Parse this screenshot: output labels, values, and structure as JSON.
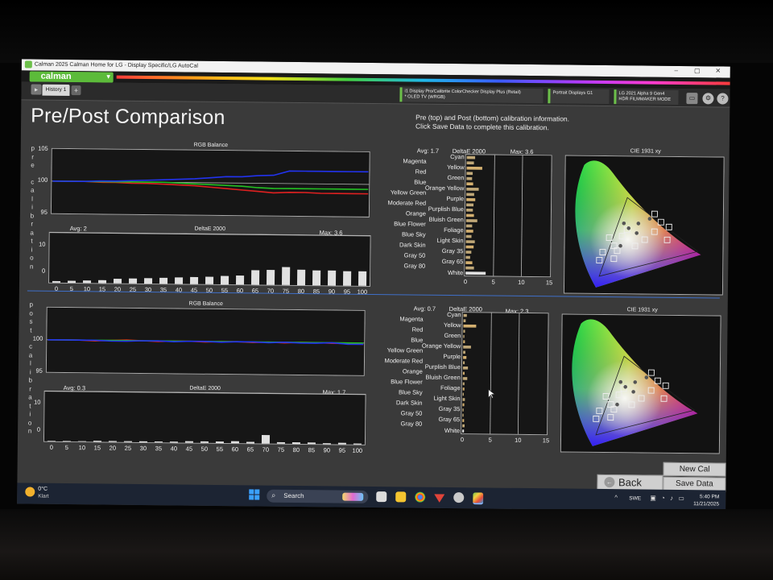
{
  "window": {
    "title": "Calman 2025 Calman Home for LG  - Display Specific/LG AutoCal",
    "min": "–",
    "max": "▢",
    "close": "✕"
  },
  "brand": {
    "name": "calman",
    "dropdown": "▾"
  },
  "tabs": {
    "history_label": "History 1",
    "add_label": "+",
    "devices": [
      {
        "line1": "i1 Display Pro/Calibrite ColorChecker Display Plus (Retail)",
        "line2": "* OLED TV (WRGB)"
      },
      {
        "line1": "Portrait Displays G1",
        "line2": ""
      },
      {
        "line1": "LG 2021 Alpha 9 Gen4",
        "line2": "HDR FILMMAKER MODE"
      }
    ]
  },
  "page": {
    "title": "Pre/Post Comparison",
    "info_line1": "Pre (top) and Post (bottom) calibration information.",
    "info_line2": "Click Save Data to complete this calibration."
  },
  "side_labels": {
    "pre": "pre calibration",
    "post": "post calibration"
  },
  "colors": {
    "accent": "#6cc04a",
    "red": "#e02020",
    "green": "#22c022",
    "blue": "#2233ee",
    "bar": "#d4b070",
    "bar_gray": "#e0e0e0"
  },
  "chart_data": [
    {
      "type": "line",
      "id": "pre-rgb-balance",
      "title": "RGB Balance",
      "x": [
        0,
        5,
        10,
        15,
        20,
        25,
        30,
        35,
        40,
        45,
        50,
        55,
        60,
        65,
        70,
        75,
        80,
        85,
        90,
        95,
        100
      ],
      "ylim": [
        95,
        105
      ],
      "yticks": [
        "105",
        "100",
        "95"
      ],
      "series": [
        {
          "color": "red",
          "values": [
            100,
            100,
            100,
            99.9,
            99.9,
            99.8,
            99.8,
            99.7,
            99.6,
            99.5,
            99.3,
            99.1,
            98.9,
            98.7,
            98.5,
            98.6,
            98.6,
            98.5,
            98.5,
            98.5,
            98.5
          ]
        },
        {
          "color": "green",
          "values": [
            100,
            100,
            100,
            100,
            100,
            100,
            100,
            100,
            99.9,
            99.8,
            99.7,
            99.6,
            99.5,
            99.3,
            99.2,
            99.2,
            99.2,
            99.2,
            99.2,
            99.2,
            99.2
          ]
        },
        {
          "color": "blue",
          "values": [
            100,
            100,
            100,
            100.1,
            100.1,
            100.2,
            100.3,
            100.4,
            100.5,
            100.6,
            100.8,
            101,
            101,
            101.2,
            101.3,
            102,
            102,
            102,
            102,
            102,
            102
          ]
        }
      ]
    },
    {
      "type": "bar",
      "id": "pre-deltae-grayscale",
      "title": "DeltaE 2000",
      "avg": "Avg: 2",
      "max": "Max: 3.6",
      "categories": [
        "0",
        "5",
        "10",
        "15",
        "20",
        "25",
        "30",
        "35",
        "40",
        "45",
        "50",
        "55",
        "60",
        "65",
        "70",
        "75",
        "80",
        "85",
        "90",
        "95",
        "100"
      ],
      "values": [
        0.3,
        0.4,
        0.5,
        0.6,
        0.9,
        1.0,
        1.1,
        1.2,
        1.3,
        1.4,
        1.5,
        1.7,
        1.8,
        2.9,
        3.0,
        3.6,
        3.1,
        3.0,
        3.0,
        2.9,
        2.9
      ],
      "ylim": [
        0,
        10
      ],
      "yticks": [
        "10",
        "0"
      ]
    },
    {
      "type": "bar",
      "id": "pre-deltae-colors",
      "orientation": "horizontal",
      "title": "DeltaE 2000",
      "avg": "Avg: 1.7",
      "max": "Max: 3.6",
      "categories": [
        "Cyan",
        "Magenta",
        "Yellow",
        "Red",
        "Green",
        "Blue",
        "Orange Yellow",
        "Yellow Green",
        "Purple",
        "Moderate Red",
        "Purplish Blue",
        "Orange",
        "Bluish Green",
        "Blue Flower",
        "Foliage",
        "Blue Sky",
        "Light Skin",
        "Dark Skin",
        "Gray 35",
        "Gray 50",
        "Gray 65",
        "Gray 80",
        "White"
      ],
      "values": [
        1.5,
        1.3,
        2.8,
        1.1,
        1.0,
        1.2,
        2.2,
        1.4,
        1.6,
        1.3,
        1.2,
        1.4,
        2.0,
        1.1,
        1.3,
        1.0,
        1.6,
        1.4,
        1.0,
        0.8,
        1.2,
        1.5,
        3.6
      ],
      "xlim": [
        0,
        15
      ],
      "xticks": [
        "0",
        "5",
        "10",
        "15"
      ]
    },
    {
      "type": "scatter",
      "id": "pre-cie",
      "title": "CIE 1931 xy"
    },
    {
      "type": "line",
      "id": "post-rgb-balance",
      "title": "RGB Balance",
      "x": [
        0,
        5,
        10,
        15,
        20,
        25,
        30,
        35,
        40,
        45,
        50,
        55,
        60,
        65,
        70,
        75,
        80,
        85,
        90,
        95,
        100
      ],
      "ylim": [
        95,
        105
      ],
      "yticks": [
        "100",
        "95"
      ],
      "series": [
        {
          "color": "red",
          "values": [
            100,
            100,
            100,
            99.9,
            100,
            100.1,
            100,
            99.9,
            100,
            100,
            99.9,
            100,
            100,
            99.9,
            100,
            99.9,
            100,
            100,
            99.9,
            99.9,
            99.8
          ]
        },
        {
          "color": "green",
          "values": [
            100,
            100,
            100,
            100,
            100,
            100,
            100,
            100,
            100,
            100,
            100,
            100,
            100,
            100,
            100,
            100,
            100,
            100,
            100,
            100,
            100
          ]
        },
        {
          "color": "blue",
          "values": [
            100,
            100,
            100,
            100,
            99.9,
            99.9,
            100,
            100,
            99.9,
            100,
            100,
            99.9,
            100,
            100,
            99.9,
            100,
            99.9,
            99.9,
            100,
            99.8,
            99.8
          ]
        }
      ]
    },
    {
      "type": "bar",
      "id": "post-deltae-grayscale",
      "title": "DeltaE 2000",
      "avg": "Avg: 0.3",
      "max": "Max: 1.7",
      "categories": [
        "0",
        "5",
        "10",
        "15",
        "20",
        "25",
        "30",
        "35",
        "40",
        "45",
        "50",
        "55",
        "60",
        "65",
        "70",
        "75",
        "80",
        "85",
        "90",
        "95",
        "100"
      ],
      "values": [
        0.1,
        0.1,
        0.1,
        0.2,
        0.2,
        0.2,
        0.2,
        0.2,
        0.2,
        0.3,
        0.3,
        0.3,
        0.4,
        0.3,
        1.7,
        0.3,
        0.3,
        0.3,
        0.2,
        0.3,
        0.2
      ],
      "ylim": [
        0,
        10
      ],
      "yticks": [
        "10",
        "0"
      ]
    },
    {
      "type": "bar",
      "id": "post-deltae-colors",
      "orientation": "horizontal",
      "title": "DeltaE 2000",
      "avg": "Avg: 0.7",
      "max": "Max: 2.3",
      "categories": [
        "Cyan",
        "Magenta",
        "Yellow",
        "Red",
        "Green",
        "Blue",
        "Orange Yellow",
        "Yellow Green",
        "Purple",
        "Moderate Red",
        "Purplish Blue",
        "Orange",
        "Bluish Green",
        "Blue Flower",
        "Foliage",
        "Blue Sky",
        "Light Skin",
        "Dark Skin",
        "Gray 35",
        "Gray 50",
        "Gray 65",
        "Gray 80",
        "White"
      ],
      "values": [
        0.6,
        0.4,
        2.3,
        0.3,
        0.2,
        0.3,
        1.4,
        0.4,
        0.6,
        0.3,
        0.9,
        0.3,
        0.8,
        0.3,
        0.3,
        0.2,
        0.4,
        0.3,
        0.2,
        0.2,
        0.3,
        0.4,
        0.3
      ],
      "xlim": [
        0,
        15
      ],
      "xticks": [
        "0",
        "5",
        "10",
        "15"
      ]
    },
    {
      "type": "scatter",
      "id": "post-cie",
      "title": "CIE 1931 xy"
    }
  ],
  "buttons": {
    "back": "Back",
    "new_cal": "New Cal",
    "save_data": "Save Data"
  },
  "taskbar": {
    "weather_temp": "0°C",
    "weather_desc": "Klart",
    "search_placeholder": "Search",
    "language": "SWE",
    "time": "5:40 PM",
    "date": "11/21/2025"
  }
}
